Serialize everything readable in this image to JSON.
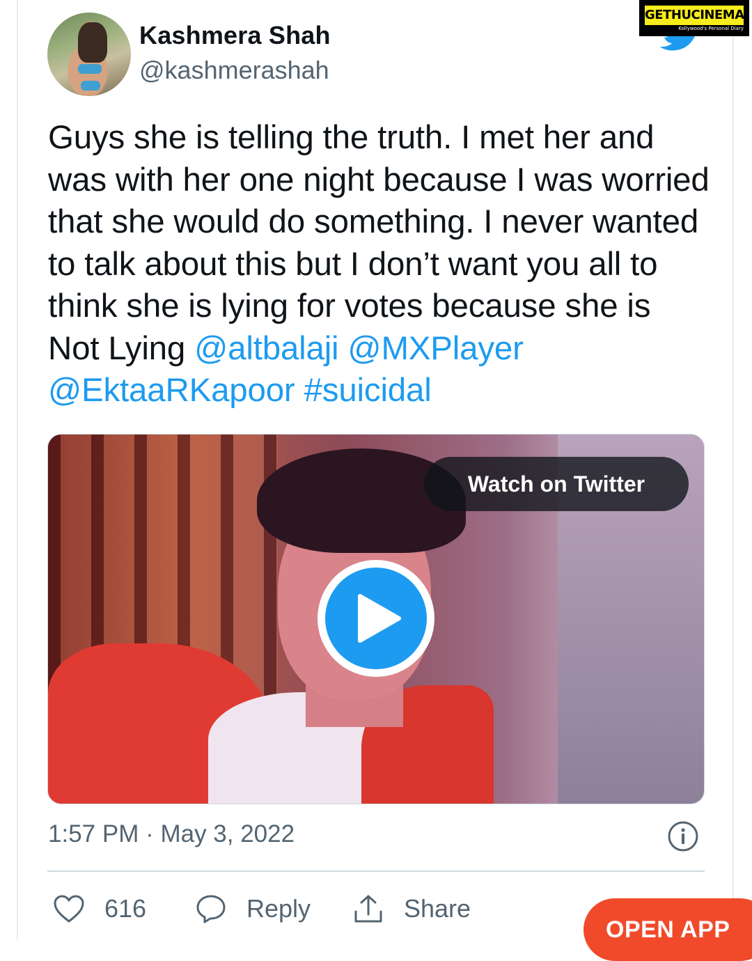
{
  "watermark": {
    "title": "GETHUCINEMA",
    "subtitle": "Kollywood's Personal Diary"
  },
  "tweet": {
    "author": {
      "display_name": "Kashmera Shah",
      "handle": "@kashmerashah"
    },
    "text_plain": "Guys she is telling the truth. I met her and was with her one night because I was worried that she would do something. I never wanted to talk about this but I don’t want you all to think she is lying for votes because she is Not Lying ",
    "mentions": [
      "@altbalaji",
      "@MXPlayer",
      "@EktaaRKapoor",
      "#suicidal"
    ],
    "media": {
      "watch_label": "Watch on Twitter"
    },
    "timestamp": "1:57 PM · May 3, 2022",
    "actions": {
      "like_count": "616",
      "reply_label": "Reply",
      "share_label": "Share"
    }
  },
  "open_app_label": "OPEN APP",
  "colors": {
    "link": "#1d9bf0",
    "secondary_text": "#536471",
    "open_app": "#f04a2a"
  }
}
